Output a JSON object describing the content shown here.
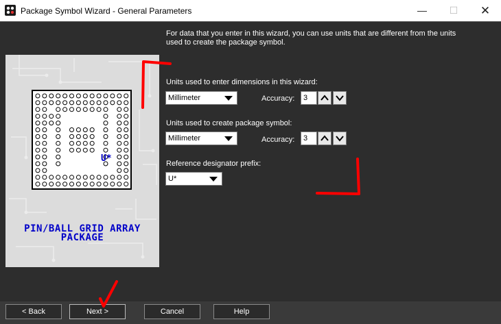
{
  "window": {
    "title": "Package Symbol Wizard - General Parameters",
    "minimize_glyph": "—",
    "maximize_glyph": "☐",
    "close_glyph": "✕"
  },
  "description": "For data that you enter in this wizard, you can use units that are different from the units used to create the package symbol.",
  "preview": {
    "designator": "U*",
    "package_line1": "PIN/BALL GRID ARRAY",
    "package_line2": "PACKAGE"
  },
  "fields": {
    "wizard_units": {
      "label": "Units used to enter dimensions in this wizard:",
      "value": "Millimeter",
      "accuracy_label": "Accuracy:",
      "accuracy_value": "3"
    },
    "symbol_units": {
      "label": "Units used to create package symbol:",
      "value": "Millimeter",
      "accuracy_label": "Accuracy:",
      "accuracy_value": "3"
    },
    "refdes": {
      "label": "Reference designator prefix:",
      "value": "U*"
    }
  },
  "buttons": {
    "back": "< Back",
    "next": "Next >",
    "cancel": "Cancel",
    "help": "Help"
  },
  "colors": {
    "background": "#2d2d2d",
    "annotation_red": "#ff0000",
    "package_text": "#0000c8"
  }
}
